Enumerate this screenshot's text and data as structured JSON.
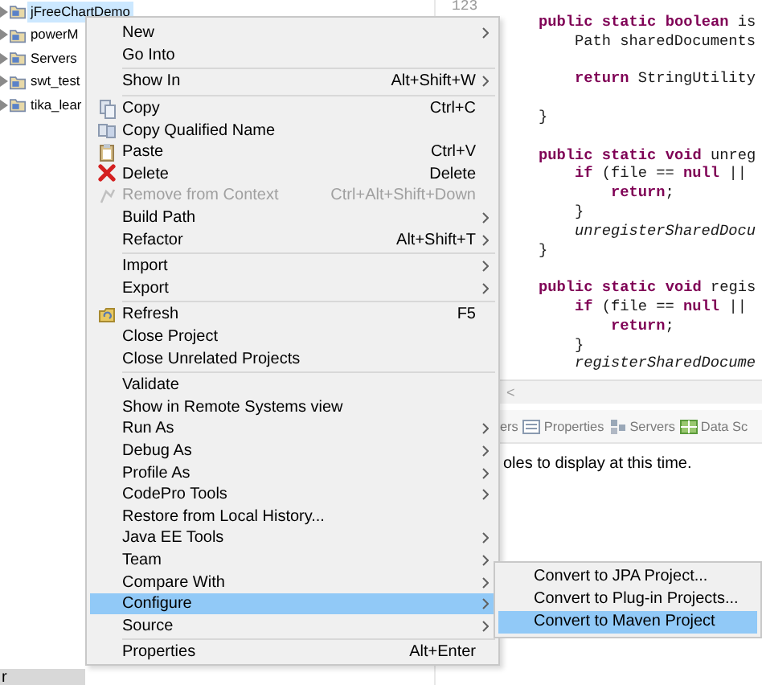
{
  "project_tree": {
    "items": [
      {
        "label": "jFreeChartDemo",
        "selected": true
      },
      {
        "label": "powerM",
        "selected": false
      },
      {
        "label": "Servers",
        "selected": false
      },
      {
        "label": "swt_test",
        "selected": false
      },
      {
        "label": "tika_lear",
        "selected": false
      }
    ]
  },
  "editor": {
    "line_number": "123",
    "blocks": [
      {
        "lines": [
          "**public** **static** **boolean** is",
          "    Path sharedDocuments"
        ]
      },
      {
        "lines": [
          "    **return** StringUtility"
        ]
      },
      {
        "lines": [
          "}"
        ]
      },
      {
        "lines": [
          "**public** **static** **void** unreg",
          "    **if** (file == **null** ||",
          "        **return**;",
          "    }",
          "    *unregisterSharedDocu*",
          "}"
        ]
      },
      {
        "lines": [
          "**public** **static** **void** regis",
          "    **if** (file == **null** ||",
          "        **return**;",
          "    }",
          "    *registerSharedDocume*"
        ]
      }
    ],
    "scroll_arrow": "<"
  },
  "bottom_panel": {
    "tabs": [
      {
        "label": "ers",
        "kind": "plain"
      },
      {
        "label": "Properties",
        "kind": "properties"
      },
      {
        "label": "Servers",
        "kind": "servers"
      },
      {
        "label": "Data Sc",
        "kind": "data"
      }
    ],
    "message": "oles to display at this time."
  },
  "status_bar": {
    "text": "r"
  },
  "context_menu": {
    "groups": [
      {
        "items": [
          {
            "label": "New",
            "submenu": true,
            "disabled": false,
            "selected": false,
            "kind": "plain"
          },
          {
            "label": "Go Into",
            "submenu": false,
            "disabled": false,
            "selected": false,
            "kind": "plain"
          }
        ]
      },
      {
        "items": [
          {
            "label": "Show In",
            "shortcut": "Alt+Shift+W",
            "submenu": true,
            "disabled": false,
            "selected": false,
            "kind": "plain"
          }
        ]
      },
      {
        "items": [
          {
            "label": "Copy",
            "shortcut": "Ctrl+C",
            "submenu": false,
            "disabled": false,
            "selected": false,
            "kind": "copy"
          },
          {
            "label": "Copy Qualified Name",
            "submenu": false,
            "disabled": false,
            "selected": false,
            "kind": "copyname"
          },
          {
            "label": "Paste",
            "shortcut": "Ctrl+V",
            "submenu": false,
            "disabled": false,
            "selected": false,
            "kind": "paste"
          },
          {
            "label": "Delete",
            "shortcut": "Delete",
            "submenu": false,
            "disabled": false,
            "selected": false,
            "kind": "delete"
          },
          {
            "label": "Remove from Context",
            "shortcut": "Ctrl+Alt+Shift+Down",
            "submenu": false,
            "disabled": true,
            "selected": false,
            "kind": "remove"
          },
          {
            "label": "Build Path",
            "submenu": true,
            "disabled": false,
            "selected": false,
            "kind": "plain"
          },
          {
            "label": "Refactor",
            "shortcut": "Alt+Shift+T",
            "submenu": true,
            "disabled": false,
            "selected": false,
            "kind": "plain"
          }
        ]
      },
      {
        "items": [
          {
            "label": "Import",
            "submenu": true,
            "disabled": false,
            "selected": false,
            "kind": "plain"
          },
          {
            "label": "Export",
            "submenu": true,
            "disabled": false,
            "selected": false,
            "kind": "plain"
          }
        ]
      },
      {
        "items": [
          {
            "label": "Refresh",
            "shortcut": "F5",
            "submenu": false,
            "disabled": false,
            "selected": false,
            "kind": "refresh"
          },
          {
            "label": "Close Project",
            "submenu": false,
            "disabled": false,
            "selected": false,
            "kind": "plain"
          },
          {
            "label": "Close Unrelated Projects",
            "submenu": false,
            "disabled": false,
            "selected": false,
            "kind": "plain"
          }
        ]
      },
      {
        "items": [
          {
            "label": "Validate",
            "submenu": false,
            "disabled": false,
            "selected": false,
            "kind": "plain"
          },
          {
            "label": "Show in Remote Systems view",
            "submenu": false,
            "disabled": false,
            "selected": false,
            "kind": "plain"
          },
          {
            "label": "Run As",
            "submenu": true,
            "disabled": false,
            "selected": false,
            "kind": "plain"
          },
          {
            "label": "Debug As",
            "submenu": true,
            "disabled": false,
            "selected": false,
            "kind": "plain"
          },
          {
            "label": "Profile As",
            "submenu": true,
            "disabled": false,
            "selected": false,
            "kind": "plain"
          },
          {
            "label": "CodePro Tools",
            "submenu": true,
            "disabled": false,
            "selected": false,
            "kind": "plain"
          },
          {
            "label": "Restore from Local History...",
            "submenu": false,
            "disabled": false,
            "selected": false,
            "kind": "plain"
          },
          {
            "label": "Java EE Tools",
            "submenu": true,
            "disabled": false,
            "selected": false,
            "kind": "plain"
          },
          {
            "label": "Team",
            "submenu": true,
            "disabled": false,
            "selected": false,
            "kind": "plain"
          },
          {
            "label": "Compare With",
            "submenu": true,
            "disabled": false,
            "selected": false,
            "kind": "plain"
          },
          {
            "label": "Configure",
            "submenu": true,
            "disabled": false,
            "selected": true,
            "kind": "plain"
          },
          {
            "label": "Source",
            "submenu": true,
            "disabled": false,
            "selected": false,
            "kind": "plain"
          }
        ]
      },
      {
        "items": [
          {
            "label": "Properties",
            "shortcut": "Alt+Enter",
            "submenu": false,
            "disabled": false,
            "selected": false,
            "kind": "plain"
          }
        ]
      }
    ]
  },
  "submenu": {
    "items": [
      {
        "label": "Convert to JPA Project...",
        "selected": false
      },
      {
        "label": "Convert to Plug-in Projects...",
        "selected": false
      },
      {
        "label": "Convert to Maven Project",
        "selected": true
      }
    ]
  }
}
